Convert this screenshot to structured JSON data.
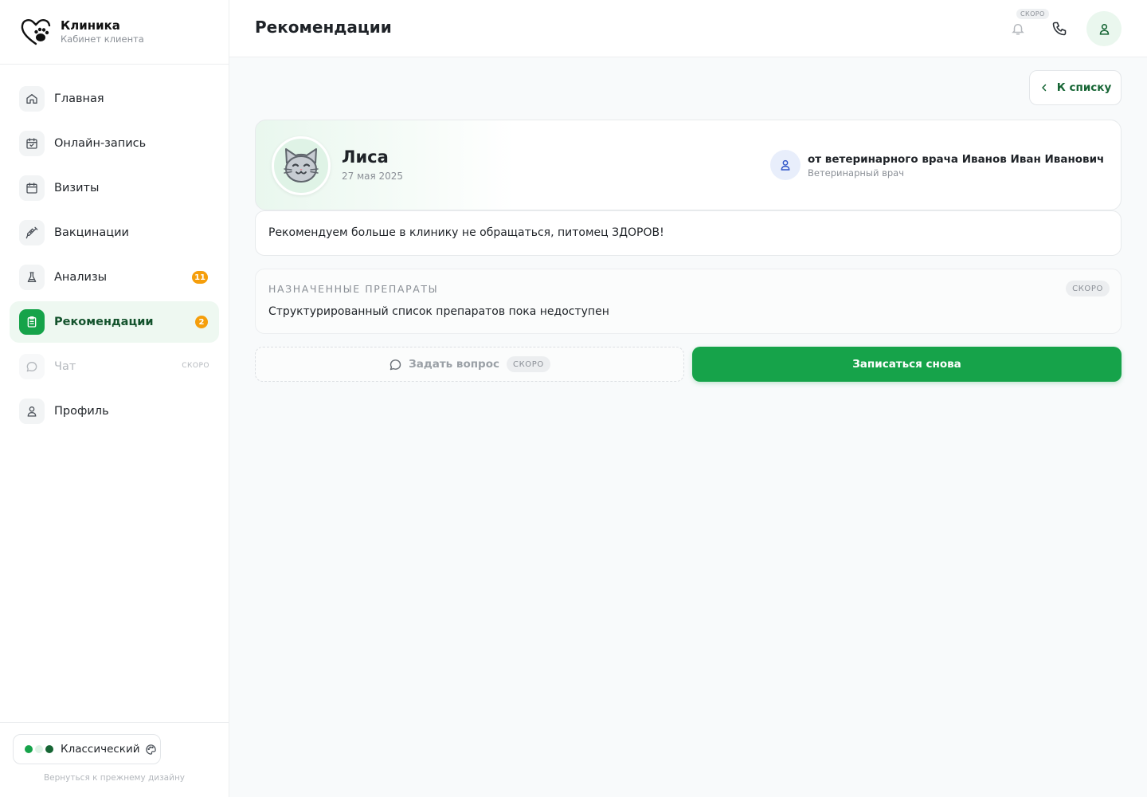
{
  "brand": {
    "title": "Клиника",
    "subtitle": "Кабинет клиента",
    "logo_icon": "heart-paw-logo"
  },
  "sidebar": {
    "items": [
      {
        "label": "Главная",
        "icon": "home-icon",
        "active": false
      },
      {
        "label": "Онлайн-запись",
        "icon": "calendar-check-icon",
        "active": false
      },
      {
        "label": "Визиты",
        "icon": "calendar-icon",
        "active": false
      },
      {
        "label": "Вакцинации",
        "icon": "syringe-icon",
        "active": false
      },
      {
        "label": "Анализы",
        "icon": "flask-icon",
        "active": false,
        "badge": "11"
      },
      {
        "label": "Рекомендации",
        "icon": "clipboard-icon",
        "active": true,
        "badge": "2"
      },
      {
        "label": "Чат",
        "icon": "chat-icon",
        "active": false,
        "disabled": true,
        "soon": "скоро"
      },
      {
        "label": "Профиль",
        "icon": "user-icon",
        "active": false
      }
    ],
    "footer": {
      "theme_label": "Классический",
      "theme_colors": [
        "#16a34a",
        "#dff3e6",
        "#166534"
      ],
      "back_link": "Вернуться к прежнему дизайну"
    }
  },
  "header": {
    "title": "Рекомендации",
    "soon_tag": "скоро"
  },
  "main": {
    "back_button": "К списку",
    "pet": {
      "name": "Лиса",
      "date": "27 мая 2025",
      "avatar_icon": "cat-icon"
    },
    "doctor": {
      "name": "от ветеринарного врача Иванов Иван Иванович",
      "role": "Ветеринарный врач"
    },
    "recommendation_text": "Рекомендуем больше в клинику не обращаться, питомец ЗДОРОВ!",
    "drugs": {
      "title": "Назначенные препараты",
      "soon": "скоро",
      "text": "Структурированный список препаратов пока недоступен"
    },
    "ask_button": {
      "label": "Задать вопрос",
      "soon": "скоро"
    },
    "book_button": "Записаться снова"
  },
  "colors": {
    "accent": "#16a34a",
    "accent_dark": "#166534",
    "badge": "#f59e0b"
  }
}
